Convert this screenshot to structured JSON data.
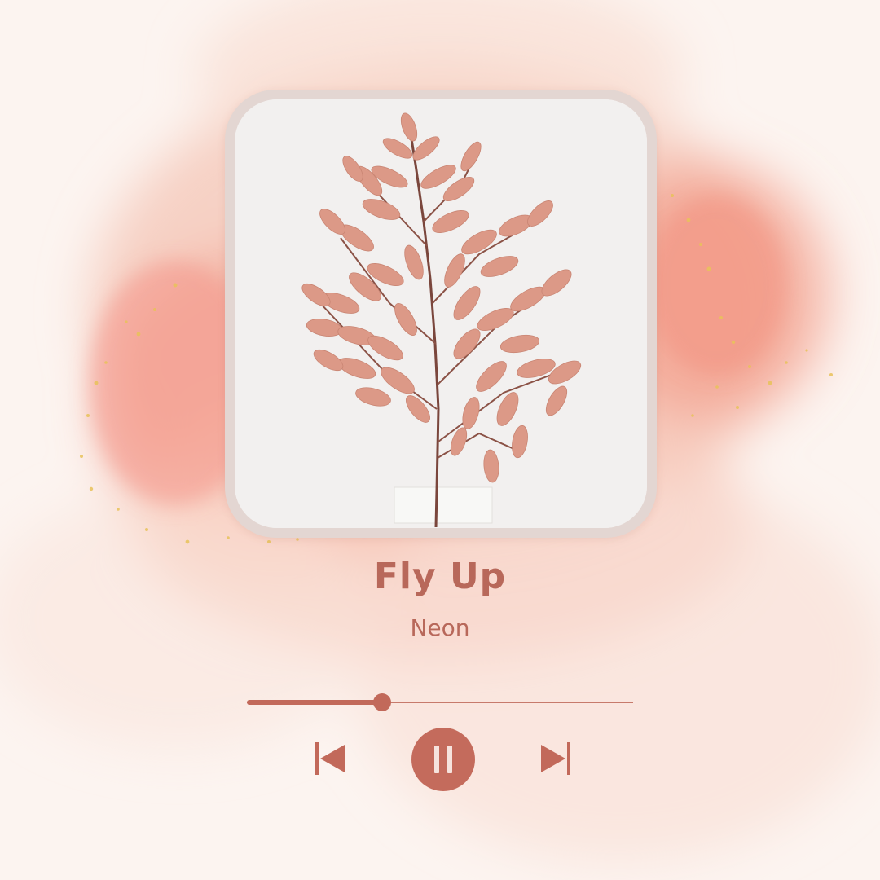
{
  "player": {
    "title": "Fly Up",
    "artist": "Neon",
    "progress_fraction": 0.35,
    "state": "playing"
  },
  "controls": {
    "previous_icon": "skip-previous-icon",
    "pause_icon": "pause-icon",
    "next_icon": "skip-next-icon"
  },
  "colors": {
    "accent": "#c2695a",
    "text": "#b8685a",
    "watercolor": "#f1a18f",
    "gold_flecks": "#e8c25a"
  },
  "artwork": {
    "icon": "fern-branch-image"
  }
}
